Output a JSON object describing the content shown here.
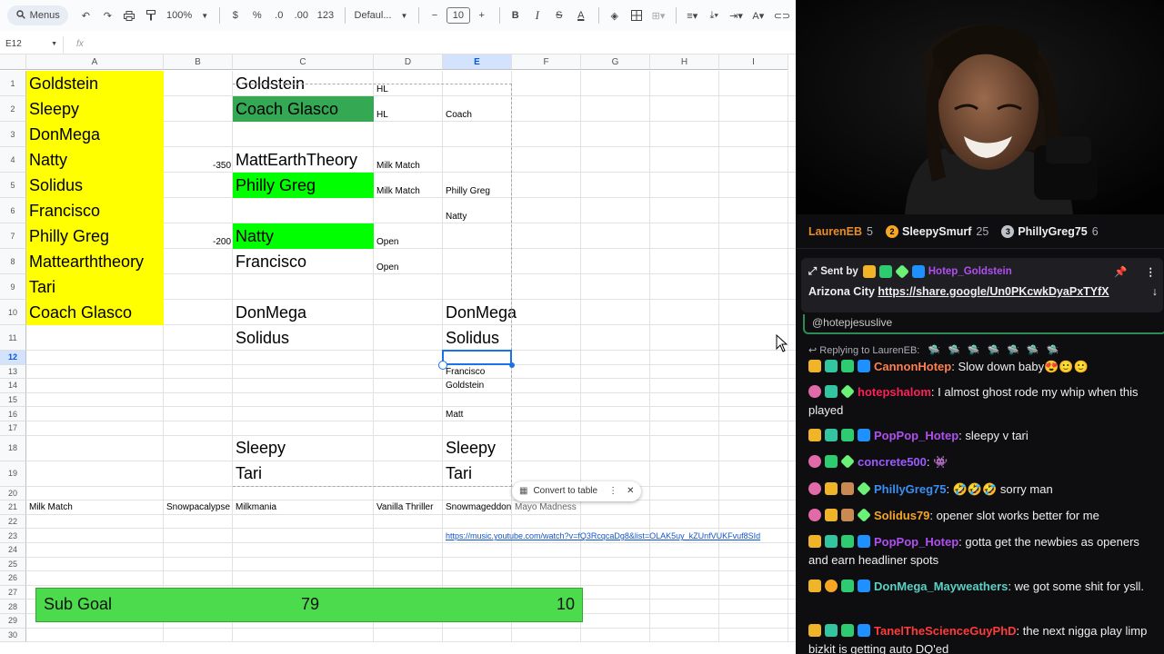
{
  "toolbar": {
    "menus_label": "Menus",
    "zoom": "100%",
    "currency": "$",
    "percent": "%",
    "dec_decrease": ".0",
    "dec_increase": ".00",
    "number_format": "123",
    "font": "Defaul...",
    "font_size": "10"
  },
  "formula_bar": {
    "cell_ref": "E12",
    "fx": "fx"
  },
  "columns": [
    "A",
    "B",
    "C",
    "D",
    "E",
    "F",
    "G",
    "H",
    "I"
  ],
  "rows": [
    "1",
    "2",
    "3",
    "4",
    "5",
    "6",
    "7",
    "8",
    "9",
    "10",
    "11",
    "12",
    "13",
    "14",
    "15",
    "16",
    "17",
    "18",
    "19",
    "20",
    "21",
    "22",
    "23",
    "24",
    "25",
    "26",
    "27",
    "28",
    "29",
    "30"
  ],
  "selected_cell": {
    "column": "E",
    "row": "12"
  },
  "cells": {
    "A1": "Goldstein",
    "A2": "Sleepy",
    "A3": "DonMega",
    "A4": "Natty",
    "A5": "Solidus",
    "A6": "Francisco",
    "A7": "Philly Greg",
    "A8": "Mattearththeory",
    "A9": "Tari",
    "A10": "Coach Glasco",
    "B4": "-350",
    "B7": "-200",
    "C1": "Goldstein",
    "C2": "Coach Glasco",
    "C4": "MattEarthTheory",
    "C5": "Philly Greg",
    "C7": "Natty",
    "C8": "Francisco",
    "C10": "DonMega",
    "C11": "Solidus",
    "C18": "Sleepy",
    "C19": "Tari",
    "D1": "HL",
    "D2": "HL",
    "D4": "Milk Match",
    "D5": "Milk Match",
    "D7": "Open",
    "D8": "Open",
    "E2": "Coach",
    "E5": "Philly Greg",
    "E6": "Natty",
    "E10": "DonMega",
    "E11": "Solidus",
    "E13": "Francisco",
    "E14": "Goldstein",
    "E16": "Matt",
    "E18": "Sleepy",
    "E19": "Tari",
    "A21": "Milk Match",
    "B21": "Snowpacalypse",
    "C21": "Milkmania",
    "D21": "Vanilla Thriller",
    "E21": "Snowmageddon",
    "F21": "Mayo Madness",
    "E23": "https://music.youtube.com/watch?v=fQ3RcqcaDg8&list=OLAK5uy_kZUnfVUKFvuf8SId"
  },
  "convert_chip": {
    "label": "Convert to table"
  },
  "sub_goal": {
    "label": "Sub Goal",
    "current": "79",
    "remaining": "10"
  },
  "chat": {
    "leaderboard": [
      {
        "name": "LaurenEB",
        "count": "5",
        "badge_color": "#e58d2b"
      },
      {
        "name": "SleepySmurf",
        "count": "25",
        "badge_color": "#f5a623"
      },
      {
        "name": "PhillyGreg75",
        "count": "6",
        "badge_color": "#bfc3c9"
      }
    ],
    "pinned": {
      "sent_by_label": "Sent by",
      "sender": "Hotep_Goldstein",
      "text_prefix": "Arizona City",
      "link": "https://share.google/Un0PKcwkDyaPxTYfX"
    },
    "reply_input": "@hotepjesuslive",
    "reply_to": "Replying to LaurenEB:",
    "messages": [
      {
        "user": "CannonHotep",
        "color": "#ff7f50",
        "text": "Slow down baby😍🙂🙂",
        "badges": [
          "crown",
          "gift",
          "sub",
          "prime"
        ]
      },
      {
        "user": "hotepshalom",
        "color": "#ff1f5a",
        "text": "I almost ghost rode my whip when this played",
        "badges": [
          "pink",
          "gift",
          "diamond"
        ]
      },
      {
        "user": "PopPop_Hotep",
        "color": "#b04ff0",
        "text": "sleepy v tari",
        "badges": [
          "crown",
          "gift",
          "sub",
          "prime"
        ]
      },
      {
        "user": "concrete500",
        "color": "#9b59ff",
        "text": "👾",
        "badges": [
          "pink",
          "sub",
          "diamond"
        ]
      },
      {
        "user": "PhillyGreg75",
        "color": "#3a8ff5",
        "text": "🤣🤣🤣 sorry man",
        "badges": [
          "pink",
          "crown",
          "mod",
          "diamond"
        ]
      },
      {
        "user": "Solidus79",
        "color": "#f5a623",
        "text": "opener slot works better for me",
        "badges": [
          "pink",
          "crown",
          "mod",
          "diamond"
        ]
      },
      {
        "user": "PopPop_Hotep",
        "color": "#b04ff0",
        "text": "gotta get the newbies as openers and earn headliner spots",
        "badges": [
          "crown",
          "gift",
          "sub",
          "prime"
        ]
      },
      {
        "user": "DonMega_Mayweathers",
        "color": "#5ad1c4",
        "text": "we got some shit for ysll.",
        "badges": [
          "crown",
          "gold",
          "sub",
          "prime"
        ]
      },
      {
        "user": "TanelTheScienceGuyPhD",
        "color": "#ff3b3b",
        "text": "the next nigga play limp bizkit is getting auto DQ'ed",
        "badges": [
          "crown",
          "gift",
          "sub",
          "prime"
        ]
      }
    ]
  },
  "colors": {
    "highlight_yellow": "#ffff00",
    "highlight_green": "#00ff00",
    "dark_green": "#34a853",
    "sub_goal_green": "#4cdb4c",
    "selection_blue": "#1a73e8",
    "chat_bg": "#0e0e10"
  }
}
